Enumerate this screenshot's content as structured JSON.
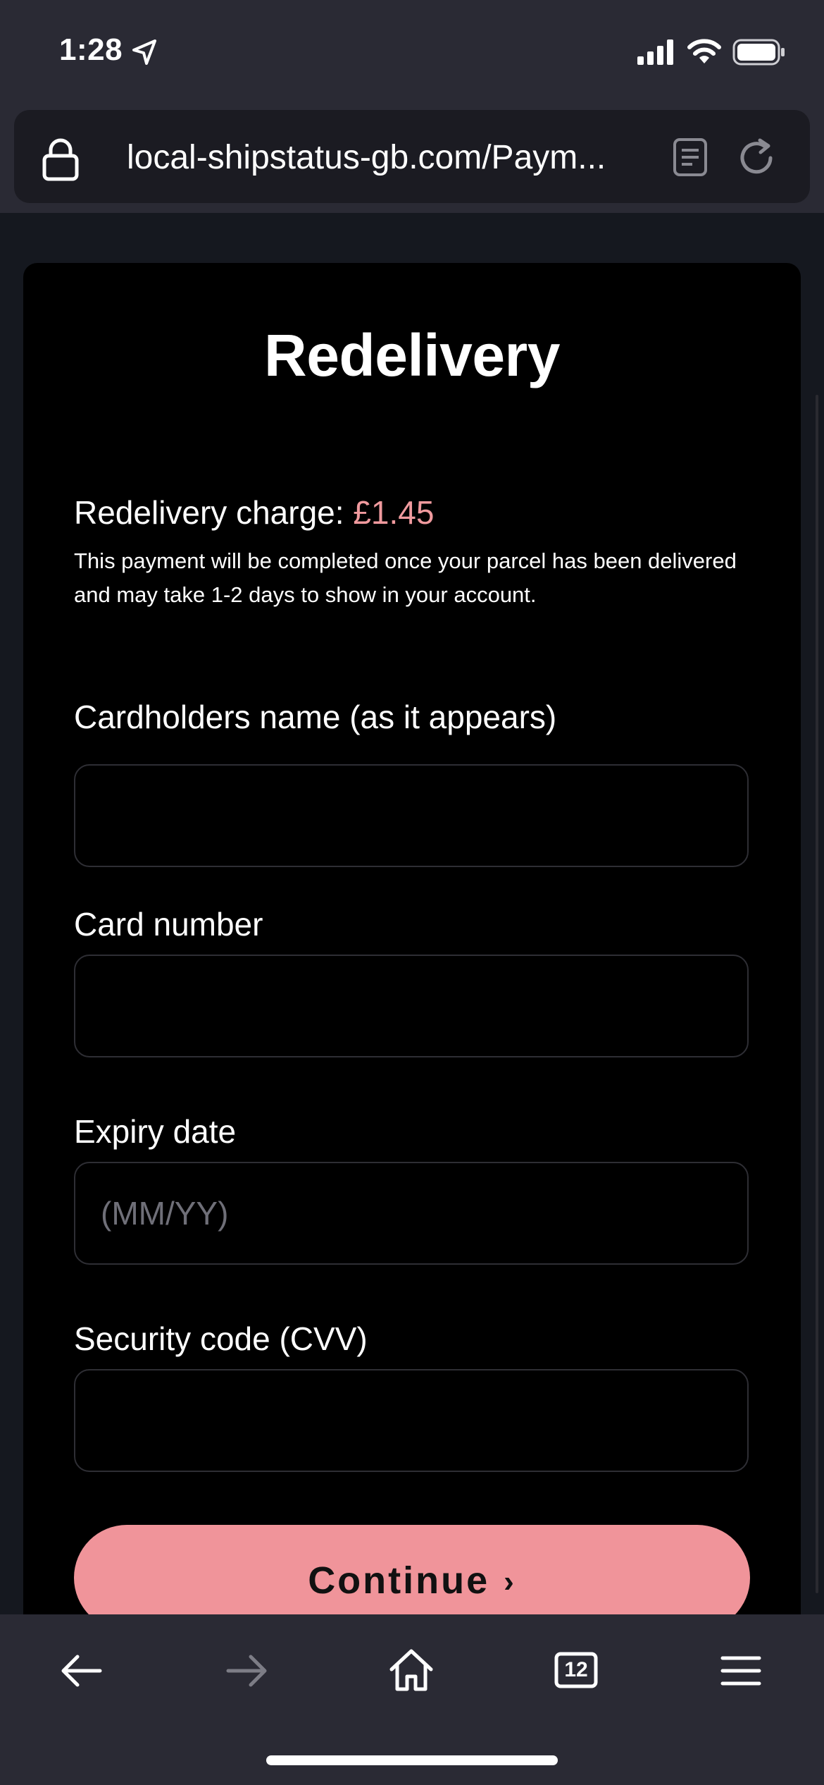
{
  "status_bar": {
    "time": "1:28"
  },
  "browser": {
    "url": "local-shipstatus-gb.com/Paym...",
    "tab_count": "12"
  },
  "page": {
    "title": "Redelivery",
    "charge_label": "Redelivery charge: ",
    "charge_amount": "£1.45",
    "charge_note": "This payment will be completed once your parcel has been delivered and may take 1-2 days to show in your account.",
    "fields": {
      "cardholder_name": {
        "label": "Cardholders name (as it appears)",
        "value": "",
        "placeholder": ""
      },
      "card_number": {
        "label": "Card number",
        "value": "",
        "placeholder": ""
      },
      "expiry_date": {
        "label": "Expiry date",
        "value": "",
        "placeholder": "(MM/YY)"
      },
      "security_code": {
        "label": "Security code (CVV)",
        "value": "",
        "placeholder": ""
      }
    },
    "continue_label": "Continue",
    "continue_chevron": "›"
  },
  "colors": {
    "accent": "#f0949a",
    "charge_amount": "#f09a9e",
    "browser_chrome": "#2a2a34",
    "page_background": "#15181f",
    "card_background": "#000000"
  },
  "icons": [
    "location-arrow-icon",
    "signal-icon",
    "wifi-icon",
    "battery-icon",
    "lock-icon",
    "reader-icon",
    "reload-icon",
    "back-arrow-icon",
    "forward-arrow-icon",
    "home-icon",
    "tabs-icon",
    "menu-icon"
  ]
}
